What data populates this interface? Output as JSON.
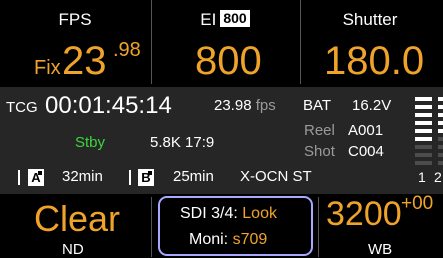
{
  "fps": {
    "title": "FPS",
    "prefix": "Fix",
    "value": "23",
    "decimal": ".98"
  },
  "ei": {
    "title": "EI",
    "badge": "800",
    "value": "800"
  },
  "shutter": {
    "title": "Shutter",
    "value": "180.0"
  },
  "timecode": {
    "label": "TCG",
    "value": "00:01:45:14",
    "rate": "23.98",
    "rate_unit": "fps"
  },
  "status": {
    "state": "Stby",
    "resolution": "5.8K 17:9"
  },
  "battery": {
    "label": "BAT",
    "value": "16.2V"
  },
  "reel": {
    "label": "Reel",
    "value": "A001"
  },
  "shot": {
    "label": "Shot",
    "value": "C004"
  },
  "media": {
    "a": {
      "letter": "A",
      "remaining": "32min"
    },
    "b": {
      "letter": "B",
      "remaining": "25min"
    },
    "format": "X-OCN ST"
  },
  "audio_meter": {
    "channels": [
      "1",
      "2"
    ]
  },
  "nd": {
    "value": "Clear",
    "label": "ND"
  },
  "sdi": {
    "label": "SDI 3/4:",
    "value": "Look"
  },
  "moni": {
    "label": "Moni:",
    "value": "s709"
  },
  "wb": {
    "value": "3200",
    "offset": "+00",
    "label": "WB"
  },
  "colors": {
    "accent": "#f0a32b",
    "standby": "#3bd63b",
    "panel": "#262626",
    "highlight_border": "#a8a8ff"
  }
}
